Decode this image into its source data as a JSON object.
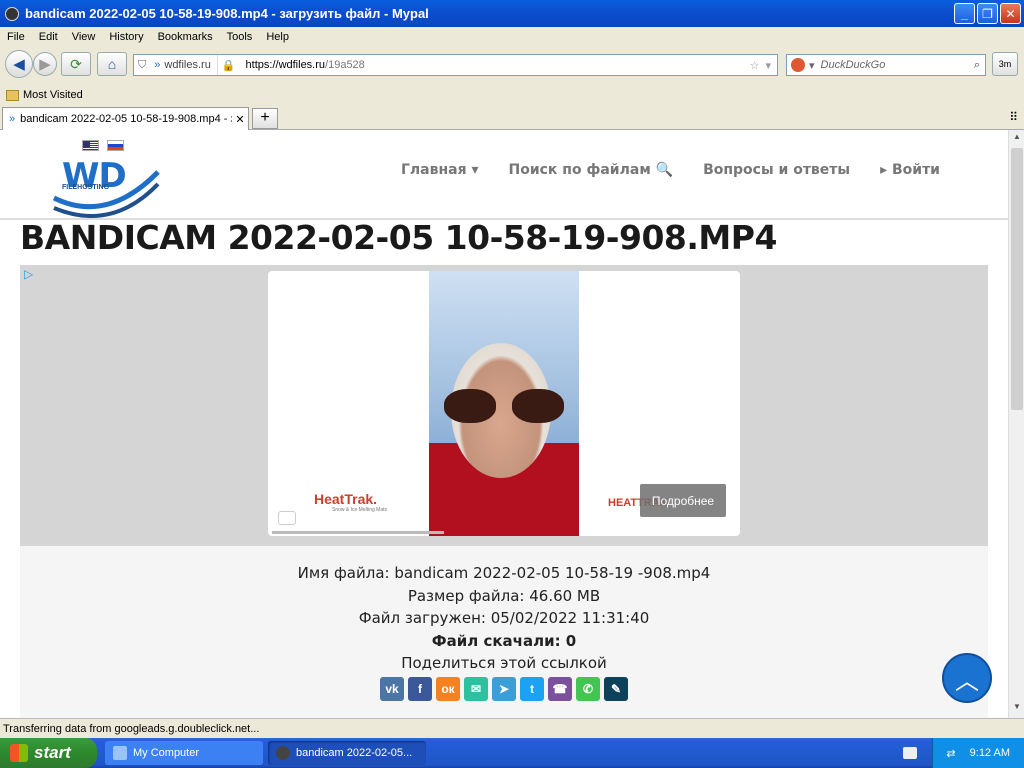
{
  "window": {
    "title": "bandicam 2022-02-05 10-58-19-908.mp4 - загрузить файл - Mypal"
  },
  "menu": [
    "File",
    "Edit",
    "View",
    "History",
    "Bookmarks",
    "Tools",
    "Help"
  ],
  "address": {
    "site": "wdfiles.ru",
    "url_host": "https://wdfiles.ru",
    "url_path": "/19a528"
  },
  "search": {
    "placeholder": "DuckDuckGo"
  },
  "toolbar": {
    "extra_button": "3m"
  },
  "bookmarks": {
    "most_visited": "Most Visited"
  },
  "tab": {
    "label": "bandicam 2022-02-05 10-58-19-908.mp4 - з..."
  },
  "site": {
    "logo_text": "WD",
    "logo_sub": "FILEHOSTING",
    "nav": [
      "Главная ▾",
      "Поиск по файлам 🔍",
      "Вопросы и ответы",
      "▸ Войти"
    ],
    "page_title": "BANDICAM 2022-02-05 10-58-19-908.MP4"
  },
  "ad": {
    "brand_left": "HeatTrak.",
    "brand_tagline": "Snow & Ice Melting Mats",
    "brand_right": "HEATTRAK",
    "more_button": "Подробнее"
  },
  "file_info": {
    "name_line": "Имя файла: bandicam 2022-02-05 10-58-19 -908.mp4",
    "size_line": "Размер файла: 46.60 MB",
    "uploaded_line": "Файл загружен: 05/02/2022 11:31:40",
    "downloads_line": "Файл скачали: 0",
    "share_line": "Поделиться этой ссылкой"
  },
  "share_buttons": [
    {
      "name": "vk",
      "glyph": "vk",
      "color": "#4C75A3"
    },
    {
      "name": "facebook",
      "glyph": "f",
      "color": "#3B5998"
    },
    {
      "name": "odnoklassniki",
      "glyph": "ок",
      "color": "#F58220"
    },
    {
      "name": "messenger",
      "glyph": "✉",
      "color": "#2DC1A0"
    },
    {
      "name": "telegram",
      "glyph": "➤",
      "color": "#3C9ED9"
    },
    {
      "name": "twitter",
      "glyph": "t",
      "color": "#1DA1F2"
    },
    {
      "name": "viber",
      "glyph": "☎",
      "color": "#7B519D"
    },
    {
      "name": "whatsapp",
      "glyph": "✆",
      "color": "#43C553"
    },
    {
      "name": "livejournal",
      "glyph": "✎",
      "color": "#0D425A"
    }
  ],
  "status": {
    "text": "Transferring data from googleads.g.doubleclick.net..."
  },
  "taskbar": {
    "start": "start",
    "tasks": [
      "My Computer",
      "bandicam 2022-02-05..."
    ],
    "clock": "9:12 AM"
  }
}
